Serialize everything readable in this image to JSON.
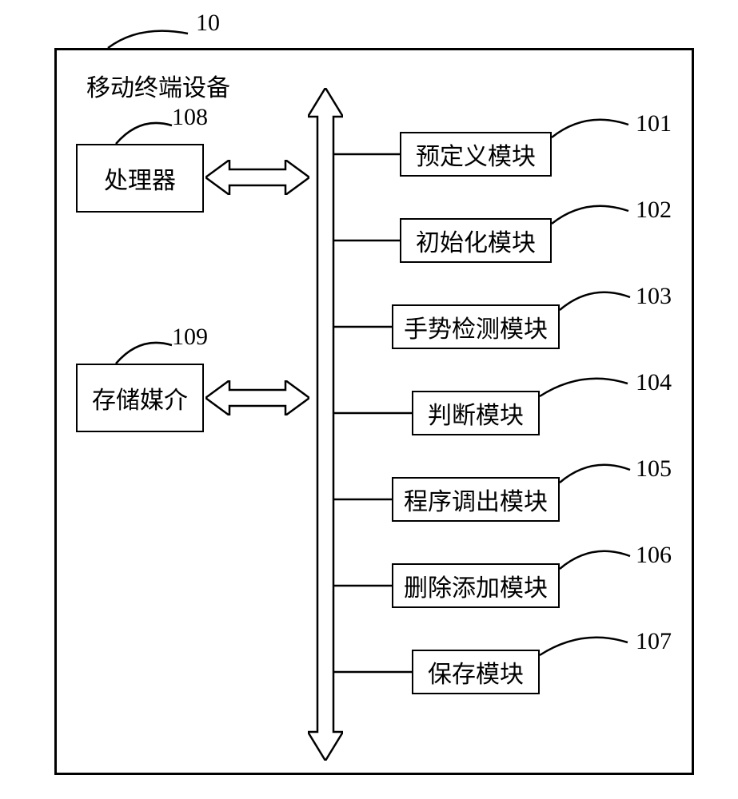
{
  "figure": {
    "label10": "10",
    "title": "移动终端设备",
    "processor": {
      "text": "处理器",
      "num": "108"
    },
    "storage": {
      "text": "存储媒介",
      "num": "109"
    },
    "modules": [
      {
        "text": "预定义模块",
        "num": "101"
      },
      {
        "text": "初始化模块",
        "num": "102"
      },
      {
        "text": "手势检测模块",
        "num": "103"
      },
      {
        "text": "判断模块",
        "num": "104"
      },
      {
        "text": "程序调出模块",
        "num": "105"
      },
      {
        "text": "删除添加模块",
        "num": "106"
      },
      {
        "text": "保存模块",
        "num": "107"
      }
    ]
  }
}
